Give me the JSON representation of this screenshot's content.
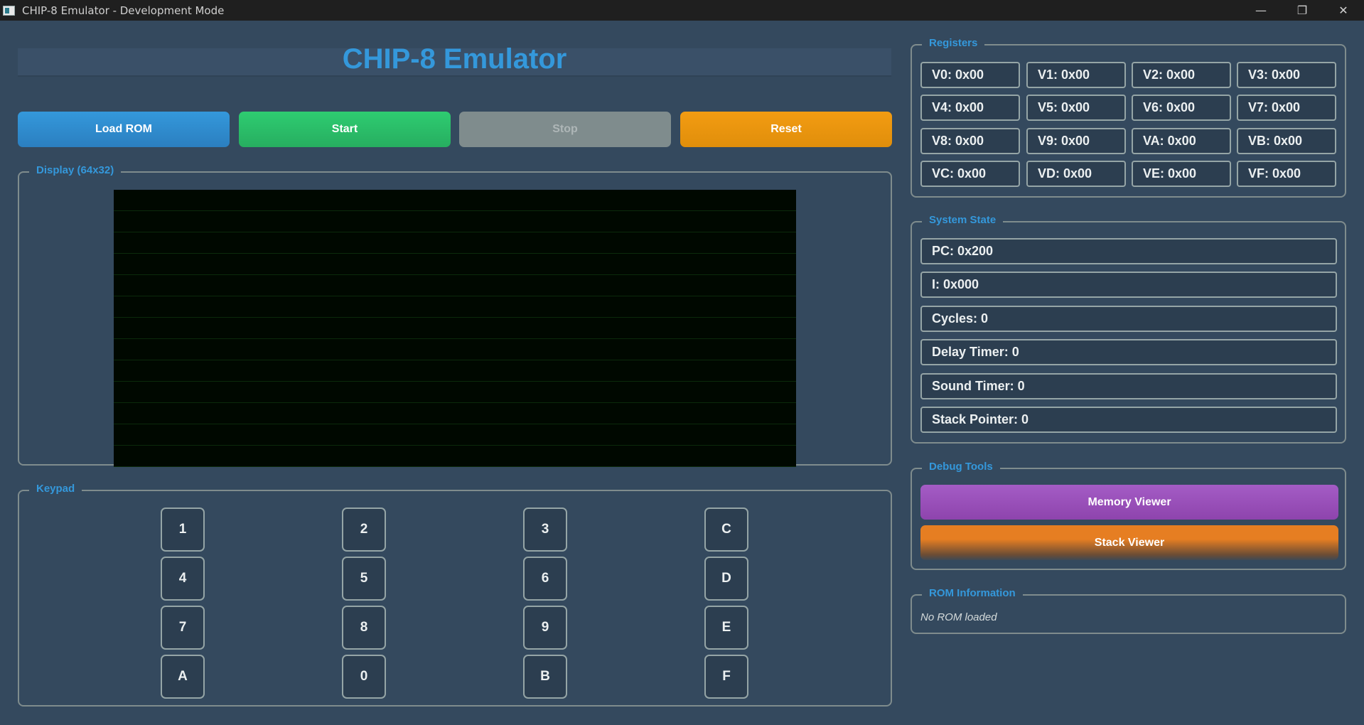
{
  "window": {
    "title": "CHIP-8 Emulator - Development Mode",
    "controls": {
      "minimize": "—",
      "restore": "❐",
      "close": "✕"
    }
  },
  "header": {
    "title": "CHIP-8 Emulator"
  },
  "controls": {
    "load_rom": "Load ROM",
    "start": "Start",
    "stop": "Stop",
    "reset": "Reset"
  },
  "display": {
    "title": "Display (64x32)"
  },
  "keypad": {
    "title": "Keypad",
    "keys": [
      "1",
      "2",
      "3",
      "C",
      "4",
      "5",
      "6",
      "D",
      "7",
      "8",
      "9",
      "E",
      "A",
      "0",
      "B",
      "F"
    ]
  },
  "registers": {
    "title": "Registers",
    "items": [
      "V0: 0x00",
      "V1: 0x00",
      "V2: 0x00",
      "V3: 0x00",
      "V4: 0x00",
      "V5: 0x00",
      "V6: 0x00",
      "V7: 0x00",
      "V8: 0x00",
      "V9: 0x00",
      "VA: 0x00",
      "VB: 0x00",
      "VC: 0x00",
      "VD: 0x00",
      "VE: 0x00",
      "VF: 0x00"
    ]
  },
  "system_state": {
    "title": "System State",
    "pc": "PC: 0x200",
    "i": "I: 0x000",
    "cycles": "Cycles: 0",
    "delay_timer": "Delay Timer: 0",
    "sound_timer": "Sound Timer: 0",
    "stack_pointer": "Stack Pointer: 0"
  },
  "debug_tools": {
    "title": "Debug Tools",
    "memory_viewer": "Memory Viewer",
    "stack_viewer": "Stack Viewer"
  },
  "rom_info": {
    "title": "ROM Information",
    "status": "No ROM loaded"
  },
  "colors": {
    "background": "#34495e",
    "accent": "#3498db",
    "start": "#2ecc71",
    "stop": "#7f8c8d",
    "reset": "#f39c12",
    "memory_viewer": "#9b59b6",
    "stack_viewer": "#e67e22"
  }
}
